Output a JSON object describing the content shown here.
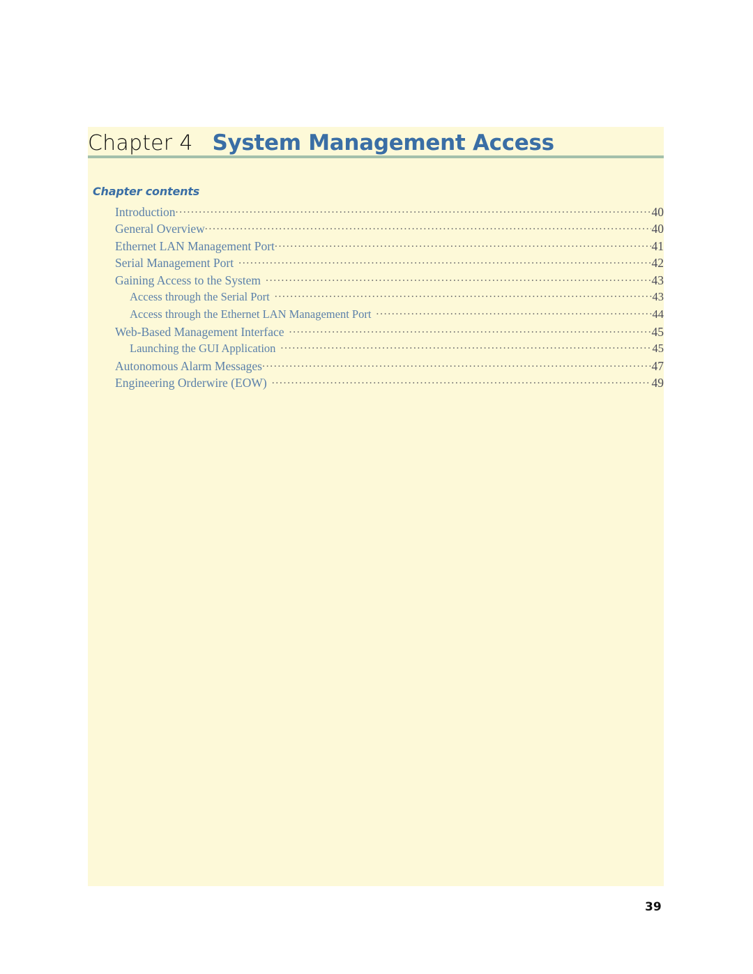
{
  "document": {
    "page_number": "39",
    "page_background": "#fdf9d8",
    "accent_blue": "#3a6ea5",
    "rule_color": "#a4c0ab",
    "toc_text_color": "#5b80aa"
  },
  "header": {
    "chapter_label": "Chapter",
    "chapter_number": "4",
    "chapter_title": "System Management Access"
  },
  "contents": {
    "heading": "Chapter contents",
    "entries": [
      {
        "title": "Introduction",
        "page": "40",
        "level": 1,
        "gap": "none"
      },
      {
        "title": "General Overview",
        "page": "40",
        "level": 1,
        "gap": "none"
      },
      {
        "title": "Ethernet LAN Management Port",
        "page": "41",
        "level": 1,
        "gap": "none"
      },
      {
        "title": "Serial Management Port",
        "page": "42",
        "level": 1,
        "gap": "wide"
      },
      {
        "title": "Gaining Access to the System",
        "page": "43",
        "level": 1,
        "gap": "wide"
      },
      {
        "title": "Access through the Serial Port",
        "page": "43",
        "level": 2,
        "gap": "wide"
      },
      {
        "title": "Access through the Ethernet LAN Management Port",
        "page": "44",
        "level": 2,
        "gap": "wide"
      },
      {
        "title": "Web-Based Management Interface",
        "page": "45",
        "level": 1,
        "gap": "wide"
      },
      {
        "title": "Launching the GUI Application",
        "page": "45",
        "level": 2,
        "gap": "wide"
      },
      {
        "title": "Autonomous Alarm Messages",
        "page": "47",
        "level": 1,
        "gap": "none"
      },
      {
        "title": "Engineering Orderwire (EOW)",
        "page": "49",
        "level": 1,
        "gap": "wide"
      }
    ]
  }
}
